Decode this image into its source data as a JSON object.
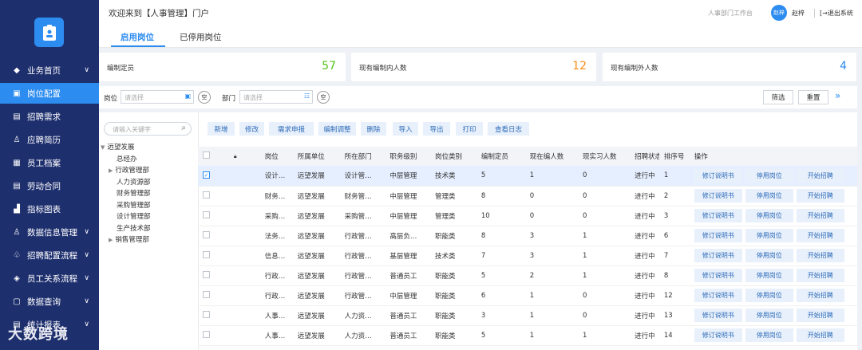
{
  "sidebar": {
    "items": [
      {
        "label": "业务首页",
        "icon": "home-icon",
        "glyph": "◆",
        "expandable": true
      },
      {
        "label": "岗位配置",
        "icon": "position-icon",
        "glyph": "▣",
        "expandable": false,
        "active": true
      },
      {
        "label": "招聘需求",
        "icon": "requirement-icon",
        "glyph": "▤",
        "expandable": false
      },
      {
        "label": "应聘简历",
        "icon": "person-icon",
        "glyph": "♙",
        "expandable": false
      },
      {
        "label": "员工档案",
        "icon": "archive-icon",
        "glyph": "▦",
        "expandable": false
      },
      {
        "label": "劳动合同",
        "icon": "contract-icon",
        "glyph": "▤",
        "expandable": false
      },
      {
        "label": "指标图表",
        "icon": "chart-icon",
        "glyph": "▟",
        "expandable": false
      },
      {
        "label": "数据信息管理",
        "icon": "data-icon",
        "glyph": "♙",
        "expandable": true
      },
      {
        "label": "招聘配置流程",
        "icon": "flow-icon",
        "glyph": "♧",
        "expandable": true
      },
      {
        "label": "员工关系流程",
        "icon": "relation-icon",
        "glyph": "◈",
        "expandable": true
      },
      {
        "label": "数据查询",
        "icon": "query-icon",
        "glyph": "▢",
        "expandable": true
      },
      {
        "label": "统计报表",
        "icon": "report-icon",
        "glyph": "▤",
        "expandable": true
      }
    ],
    "watermark": "大数跨境"
  },
  "header": {
    "title": "欢迎来到【人事管理】门户",
    "workbench": "人事部门工作台",
    "avatar_text": "赵梓",
    "username": "赵梓",
    "logout": "[→退出系统"
  },
  "tabs": [
    {
      "label": "启用岗位",
      "active": true
    },
    {
      "label": "已停用岗位",
      "active": false
    }
  ],
  "stats": [
    {
      "label": "编制定员",
      "value": "57",
      "color": "#52c41a"
    },
    {
      "label": "现有编制内人数",
      "value": "12",
      "color": "#fa8c16"
    },
    {
      "label": "现有编制外人数",
      "value": "4",
      "color": "#2d8cf0"
    }
  ],
  "filters": {
    "position_label": "岗位",
    "position_placeholder": "请选择",
    "dept_label": "部门",
    "dept_placeholder": "请选择",
    "clear": "空",
    "filter_btn": "筛选",
    "reset_btn": "重置",
    "expand": "»"
  },
  "tree": {
    "search_placeholder": "请输入关键字",
    "nodes": [
      {
        "label": "远望发展",
        "level": 0,
        "arrow": "▼"
      },
      {
        "label": "总经办",
        "level": 1,
        "arrow": ""
      },
      {
        "label": "行政管理部",
        "level": 1,
        "arrow": "▶"
      },
      {
        "label": "人力资源部",
        "level": 1,
        "arrow": ""
      },
      {
        "label": "财务管理部",
        "level": 1,
        "arrow": ""
      },
      {
        "label": "采购管理部",
        "level": 1,
        "arrow": ""
      },
      {
        "label": "设计管理部",
        "level": 1,
        "arrow": ""
      },
      {
        "label": "生产技术部",
        "level": 1,
        "arrow": ""
      },
      {
        "label": "销售管理部",
        "level": 1,
        "arrow": "▶"
      }
    ]
  },
  "actions": [
    "新增",
    "修改",
    "需求申报",
    "编制调整",
    "删除",
    "导入",
    "导出",
    "打印",
    "查看日志"
  ],
  "table": {
    "headers": [
      "岗位",
      "所属单位",
      "所在部门",
      "职务级别",
      "岗位类别",
      "编制定员",
      "现在编人数",
      "现实习人数",
      "招聘状态",
      "排序号",
      "操作"
    ],
    "op_labels": [
      "修订说明书",
      "停用岗位",
      "开始招聘"
    ],
    "rows": [
      {
        "selected": true,
        "cells": [
          "设计…",
          "远望发展",
          "设计管…",
          "中层管理",
          "技术类",
          "5",
          "1",
          "0",
          "进行中",
          "1"
        ]
      },
      {
        "selected": false,
        "cells": [
          "财务…",
          "远望发展",
          "财务管…",
          "中层管理",
          "管理类",
          "8",
          "0",
          "0",
          "进行中",
          "2"
        ]
      },
      {
        "selected": false,
        "cells": [
          "采购…",
          "远望发展",
          "采购管…",
          "中层管理",
          "管理类",
          "10",
          "0",
          "0",
          "进行中",
          "3"
        ]
      },
      {
        "selected": false,
        "cells": [
          "法务…",
          "远望发展",
          "行政管…",
          "高层负…",
          "职能类",
          "8",
          "3",
          "1",
          "进行中",
          "6"
        ]
      },
      {
        "selected": false,
        "cells": [
          "信息…",
          "远望发展",
          "行政管…",
          "基层管理",
          "技术类",
          "7",
          "3",
          "1",
          "进行中",
          "7"
        ]
      },
      {
        "selected": false,
        "cells": [
          "行政…",
          "远望发展",
          "行政管…",
          "普通员工",
          "职能类",
          "5",
          "2",
          "1",
          "进行中",
          "8"
        ]
      },
      {
        "selected": false,
        "cells": [
          "行政…",
          "远望发展",
          "行政管…",
          "中层管理",
          "职能类",
          "6",
          "1",
          "0",
          "进行中",
          "12"
        ]
      },
      {
        "selected": false,
        "cells": [
          "人事…",
          "远望发展",
          "人力资…",
          "普通员工",
          "职能类",
          "3",
          "1",
          "0",
          "进行中",
          "13"
        ]
      },
      {
        "selected": false,
        "cells": [
          "人事…",
          "远望发展",
          "人力资…",
          "普通员工",
          "职能类",
          "5",
          "1",
          "1",
          "进行中",
          "14"
        ]
      }
    ]
  }
}
